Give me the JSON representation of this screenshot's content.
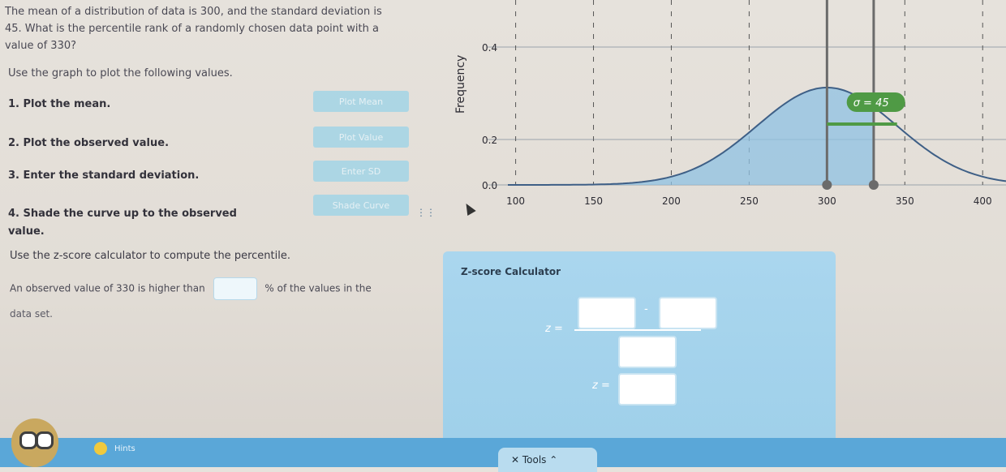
{
  "question": {
    "line1": "The mean of a distribution of data is 300, and the standard deviation is",
    "line2": "45. What is the percentile rank of a randomly chosen data point with a",
    "line3": "value of 330?"
  },
  "instruction": "Use the graph to plot the following values.",
  "steps": [
    {
      "label": "1. Plot the mean.",
      "button": "Plot Mean"
    },
    {
      "label": "2. Plot the observed value.",
      "button": "Plot Value"
    },
    {
      "label": "3. Enter the standard deviation.",
      "button": "Enter SD"
    },
    {
      "label": "4. Shade the curve up to the observed value.",
      "button": "Shade Curve"
    }
  ],
  "grip_icon": "⋮⋮",
  "zscore_instruction": "Use the z-score calculator to compute the percentile.",
  "sentence": {
    "before": "An observed value of 330 is higher than",
    "after": "% of the values in the",
    "line2": "data set."
  },
  "calculator": {
    "title": "Z-score Calculator",
    "z_label": "z =",
    "minus": "-",
    "z_result_label": "z ="
  },
  "chart_data": {
    "type": "line",
    "ylabel": "Frequency",
    "x_ticks": [
      100,
      150,
      200,
      250,
      300,
      350,
      400
    ],
    "y_tick_labels": [
      "0.0",
      "0.2",
      "0.4"
    ],
    "xlim": [
      95,
      415
    ],
    "mean": 300,
    "observed_value": 330,
    "sd": 45,
    "sigma_label": "σ = 45",
    "shaded_to": 330
  },
  "colors": {
    "curve": "#3e5f86",
    "shade": "#8fc1e3",
    "grid": "#9aa3ab",
    "marker": "#6b6b6b",
    "sigma_badge": "#4f9a45",
    "button": "#a7d6e6",
    "calculator": "#a6d4ec",
    "footer": "#5aa7d8"
  },
  "footer": {
    "hints": "Hints",
    "tools": "✕ Tools ⌃"
  }
}
